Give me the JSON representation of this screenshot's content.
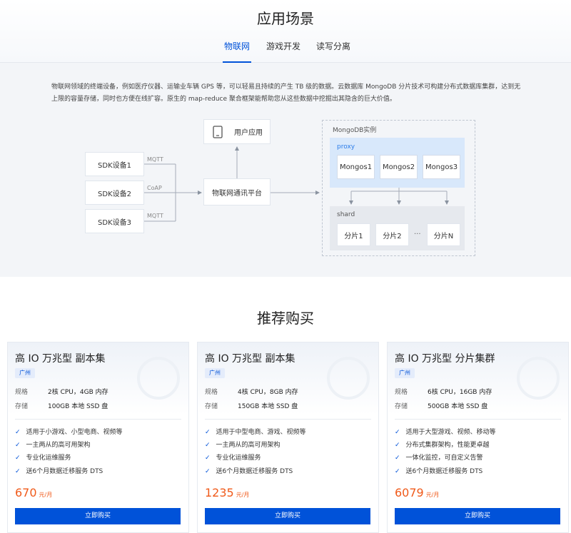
{
  "scenario": {
    "title": "应用场景",
    "tabs": [
      {
        "label": "物联网",
        "active": true
      },
      {
        "label": "游戏开发",
        "active": false
      },
      {
        "label": "读写分离",
        "active": false
      }
    ],
    "description": "物联网领域的终端设备，例如医疗仪器、运输业车辆 GPS 等，可以轻易且持续的产生 TB 级的数据。云数据库 MongoDB 分片技术可构建分布式数据库集群，达到无上限的容量存储，同时也方便在线扩容。原生的 map-reduce 聚合框架能帮助您从这些数据中挖掘出其隐含的巨大价值。",
    "diagram": {
      "devices": [
        "SDK设备1",
        "SDK设备2",
        "SDK设备3"
      ],
      "protocols": [
        "MQTT",
        "CoAP",
        "MQTT"
      ],
      "platform": "物联网通讯平台",
      "user_app": "用户应用",
      "mongo_title": "MongoDB实例",
      "proxy_label": "proxy",
      "mongos": [
        "Mongos1",
        "Mongos2",
        "Mongos3"
      ],
      "shard_label": "shard",
      "shards": [
        "分片1",
        "分片2",
        "分片N"
      ],
      "ellipsis": "···"
    }
  },
  "purchase": {
    "title": "推荐购买",
    "spec_label": "规格",
    "storage_label": "存储",
    "buy_label": "立即购买",
    "price_unit": "元/月",
    "accent": "#0052d9",
    "price_color": "#f05a1a",
    "cards": [
      {
        "name": "高 IO 万兆型 副本集",
        "region": "广州",
        "spec": "2核 CPU，4GB 内存",
        "storage": "100GB 本地 SSD 盘",
        "features": [
          "适用于小游戏、小型电商、视频等",
          "一主两从的高可用架构",
          "专业化运维服务",
          "送6个月数据迁移服务 DTS"
        ],
        "price": "670"
      },
      {
        "name": "高 IO 万兆型 副本集",
        "region": "广州",
        "spec": "4核 CPU，8GB 内存",
        "storage": "150GB 本地 SSD 盘",
        "features": [
          "适用于中型电商、游戏、视频等",
          "一主两从的高可用架构",
          "专业化运维服务",
          "送6个月数据迁移服务 DTS"
        ],
        "price": "1235"
      },
      {
        "name": "高 IO 万兆型 分片集群",
        "region": "广州",
        "spec": "6核 CPU，16GB 内存",
        "storage": "500GB 本地 SSD 盘",
        "features": [
          "适用于大型游戏、视频、移动等",
          "分布式集群架构，性能更卓越",
          "一体化监控，可自定义告警",
          "送6个月数据迁移服务 DTS"
        ],
        "price": "6079"
      }
    ]
  }
}
